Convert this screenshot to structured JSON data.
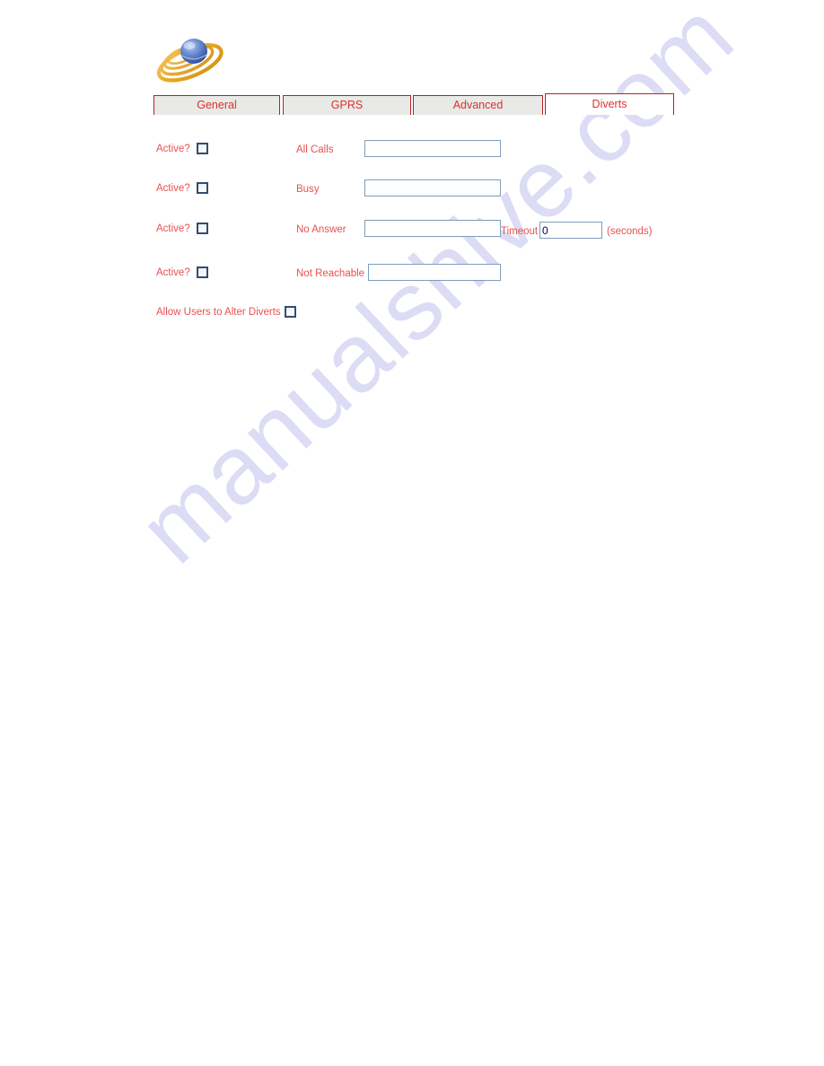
{
  "page": {
    "background_color": "#ffffff",
    "watermark": "manualshive.com",
    "watermark_color": "#c8c8f0"
  },
  "logo": {
    "name": "orbit-sphere-logo",
    "sphere_color": "#5a7fc4",
    "ring_color": "#e8a317"
  },
  "tabs": [
    {
      "label": "General",
      "active": false
    },
    {
      "label": "GPRS",
      "active": false
    },
    {
      "label": "Advanced",
      "active": false
    },
    {
      "label": "Diverts",
      "active": true
    }
  ],
  "theme": {
    "tab_border": "#b42222",
    "tab_text": "#e03030",
    "tab_inactive_bg": "#e7eae6",
    "tab_active_bg": "#ffffff",
    "label_text": "#e85050",
    "input_border": "#7f9db9",
    "checkbox_border": "#2f4f6f"
  },
  "form": {
    "active_label": "Active?",
    "rows": [
      {
        "active_label": "Active?",
        "active_checked": false,
        "field_label": "All Calls",
        "value": "",
        "placeholder": ""
      },
      {
        "active_label": "Active?",
        "active_checked": false,
        "field_label": "Busy",
        "value": "",
        "placeholder": ""
      },
      {
        "active_label": "Active?",
        "active_checked": false,
        "field_label": "No Answer",
        "value": "",
        "placeholder": "",
        "timeout_label": "Timeout",
        "timeout_value": "0",
        "timeout_units": "(seconds)"
      },
      {
        "active_label": "Active?",
        "active_checked": false,
        "field_label": "Not Reachable",
        "value": "",
        "placeholder": ""
      }
    ],
    "allow_users": {
      "label": "Allow Users to Alter Diverts",
      "checked": false
    }
  }
}
